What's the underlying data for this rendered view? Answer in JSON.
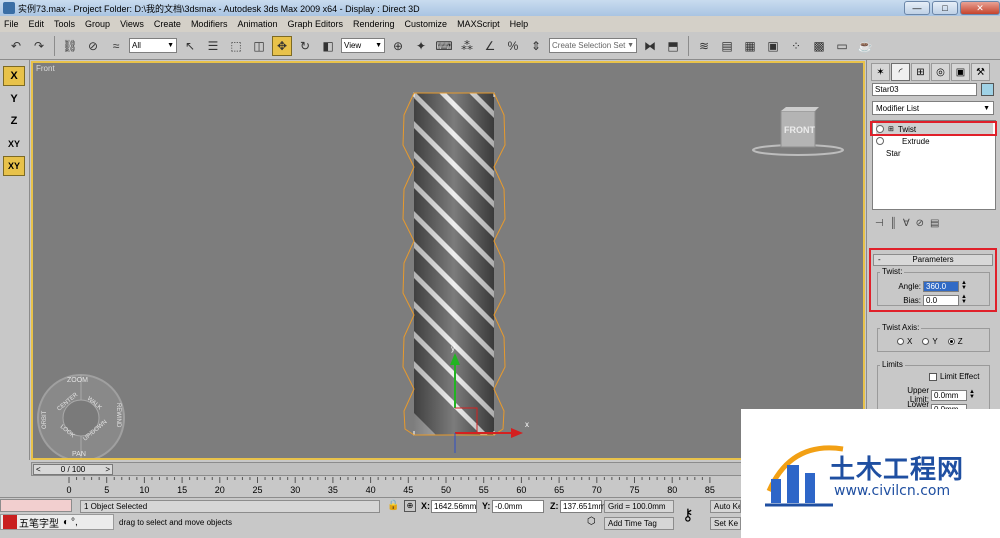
{
  "window": {
    "title": "实例73.max    - Project Folder: D:\\我的文档\\3dsmax    - Autodesk 3ds Max  2009 x64       - Display : Direct 3D",
    "minimize": "—",
    "maximize": "□",
    "close": "✕"
  },
  "menu": [
    "File",
    "Edit",
    "Tools",
    "Group",
    "Views",
    "Create",
    "Modifiers",
    "Animation",
    "Graph Editors",
    "Rendering",
    "Customize",
    "MAXScript",
    "Help"
  ],
  "toolbar": {
    "filter_value": "All",
    "refcoord_value": "View",
    "named_selection_placeholder": "Create Selection Set"
  },
  "axis_buttons": [
    "X",
    "Y",
    "Z",
    "XY",
    "XY"
  ],
  "viewport": {
    "label": "Front",
    "viewcube_label": "FRONT",
    "gizmo_x": "x",
    "gizmo_y": "y",
    "steering_wheel": {
      "zoom": "ZOOM",
      "orbit": "ORBIT",
      "center": "CENTER",
      "walk": "WALK",
      "rewind": "REWIND",
      "look": "LOOK",
      "updown": "UP/DOWN",
      "pan": "PAN"
    }
  },
  "command_panel": {
    "object_name": "Star03",
    "object_color": "#9fd2e6",
    "modifier_list_label": "Modifier List",
    "stack": [
      "Twist",
      "Extrude",
      "Star"
    ],
    "parameters_title": "Parameters",
    "twist_group_label": "Twist:",
    "angle_label": "Angle:",
    "angle_value": "360.0",
    "bias_label": "Bias:",
    "bias_value": "0.0",
    "twist_axis_label": "Twist Axis:",
    "axis_options": [
      "X",
      "Y",
      "Z"
    ],
    "axis_selected": "Z",
    "limits_label": "Limits",
    "limit_effect_label": "Limit Effect",
    "upper_limit_label": "Upper Limit:",
    "upper_limit_value": "0.0mm",
    "lower_limit_label": "Lower Limit:",
    "lower_limit_value": "0.0mm"
  },
  "timeline": {
    "frame_display": "0 / 100",
    "ticks": [
      "0",
      "5",
      "10",
      "15",
      "20",
      "25",
      "30",
      "35",
      "40",
      "45",
      "50",
      "55",
      "60",
      "65",
      "70",
      "75",
      "80",
      "85"
    ]
  },
  "status": {
    "selection": "1 Object Selected",
    "prompt": "drag to select and move objects",
    "x_label": "X:",
    "x_value": "1642.56mm",
    "y_label": "Y:",
    "y_value": "-0.0mm",
    "z_label": "Z:",
    "z_value": "137.651mm",
    "grid": "Grid = 100.0mm",
    "add_time_tag": "Add Time Tag",
    "auto_key": "Auto Ke",
    "set_key": "Set Ke",
    "ime": "五笔字型"
  },
  "watermark": {
    "title": "土木工程网",
    "url": "www.civilcn.com"
  }
}
